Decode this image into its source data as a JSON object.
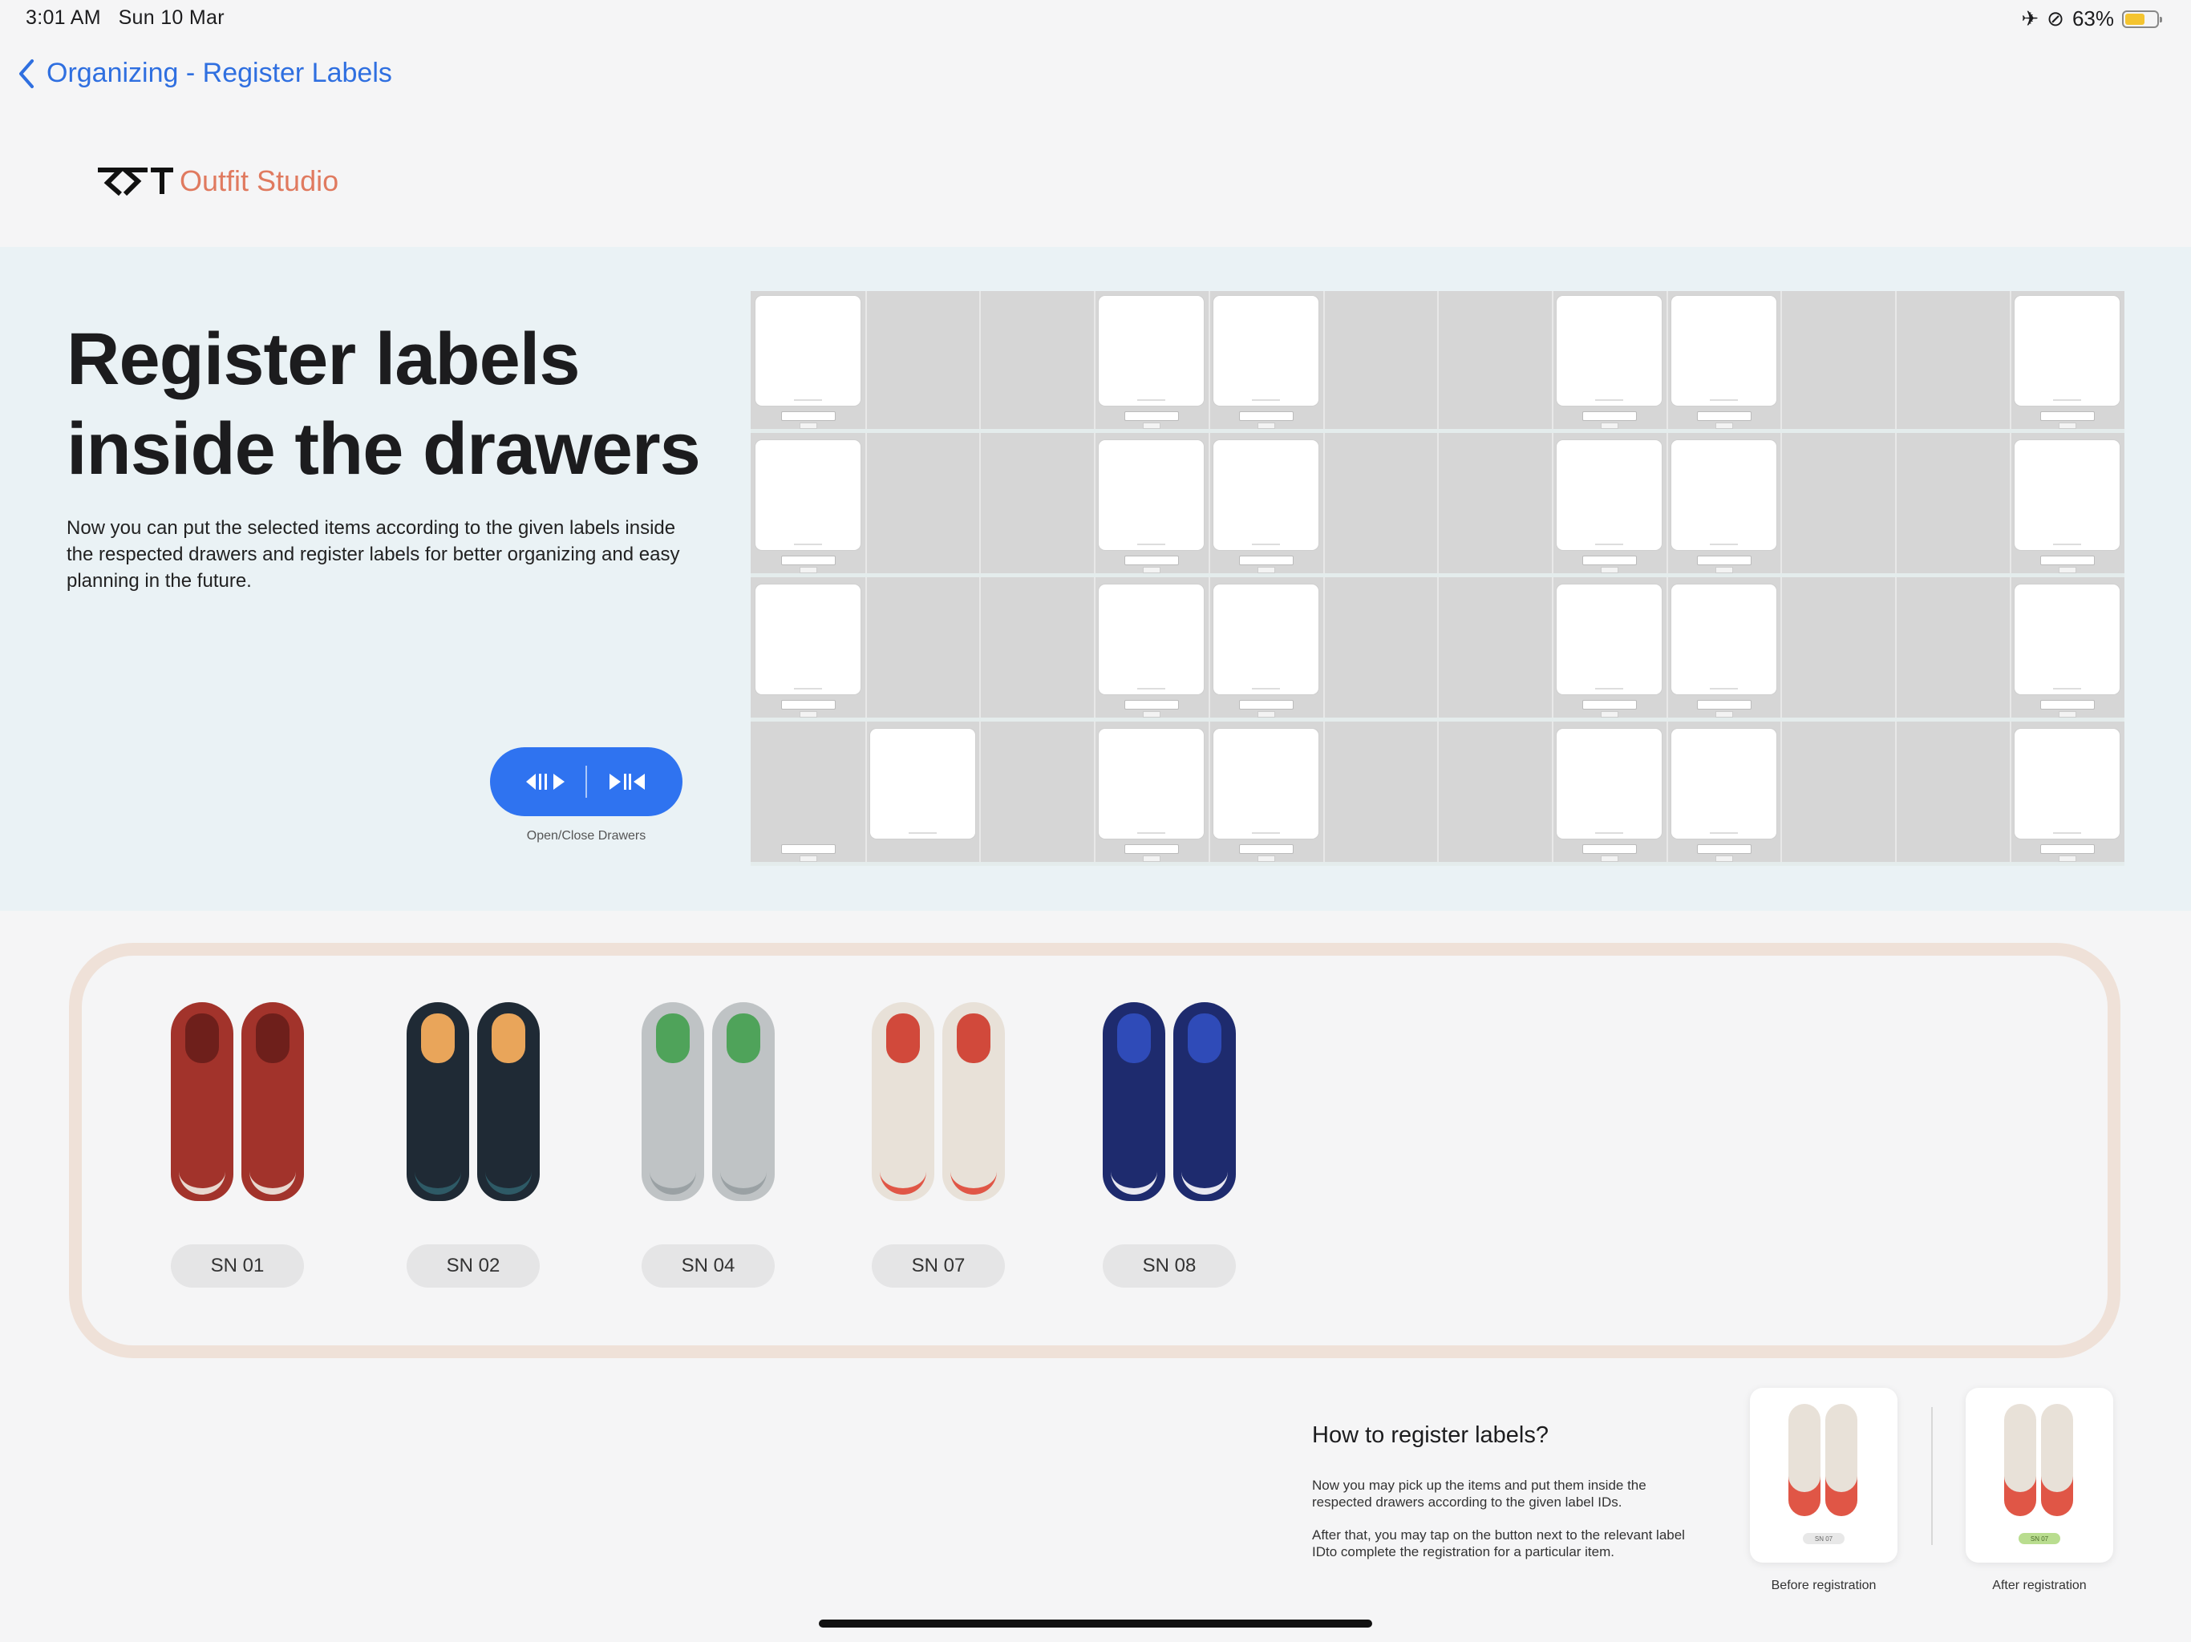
{
  "status": {
    "time": "3:01 AM",
    "date": "Sun 10 Mar",
    "battery": "63%",
    "battery_level": 0.63
  },
  "nav": {
    "back_label": "Organizing - Register Labels"
  },
  "brand": {
    "name": "Outfit Studio",
    "accent": "#e07a5f"
  },
  "hero": {
    "title_line1": "Register labels",
    "title_line2": "inside the drawers",
    "description": "Now you can put the selected items according to the given labels inside the respected drawers and register labels for better organizing and easy planning in the future.",
    "toggle_caption": "Open/Close Drawers"
  },
  "items": [
    {
      "label": "SN 01",
      "colors": {
        "body": "#a2332b",
        "inner": "#6e1f1b",
        "sole": "#e8d8d0"
      }
    },
    {
      "label": "SN 02",
      "colors": {
        "body": "#1f2a35",
        "inner": "#e9a55a",
        "sole": "#2e5a66"
      }
    },
    {
      "label": "SN 04",
      "colors": {
        "body": "#bfc3c5",
        "inner": "#4fa35a",
        "sole": "#9aa1a4"
      }
    },
    {
      "label": "SN 07",
      "colors": {
        "body": "#e8e1d8",
        "inner": "#d1493b",
        "sole": "#e05646"
      }
    },
    {
      "label": "SN 08",
      "colors": {
        "body": "#1e2b6e",
        "inner": "#2f4bb8",
        "sole": "#e8e8f0"
      }
    }
  ],
  "howto": {
    "title": "How to register labels?",
    "p1": "Now you may pick up the items and put them inside the respected drawers according to the given label IDs.",
    "p2": "After that, you may tap on the button next to the relevant label IDto complete the registration for a particular item.",
    "before_caption": "Before registration",
    "after_caption": "After registration",
    "sample_label": "SN 07"
  },
  "colors": {
    "link": "#2f6fe0",
    "button": "#2f73f0",
    "hero_bg": "#eaf2f5",
    "panel_border": "#efe1d8",
    "registered_tag": "#b9dd8f"
  }
}
